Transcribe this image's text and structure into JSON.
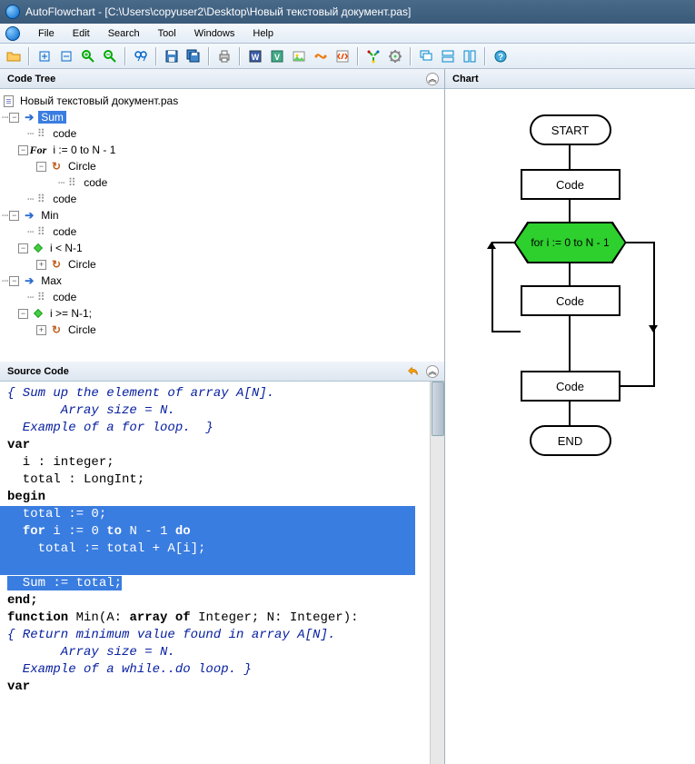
{
  "window": {
    "title": "AutoFlowchart - [C:\\Users\\copyuser2\\Desktop\\Новый текстовый документ.pas]"
  },
  "menubar": [
    "File",
    "Edit",
    "Search",
    "Tool",
    "Windows",
    "Help"
  ],
  "panels": {
    "code_tree": "Code Tree",
    "source": "Source Code",
    "chart": "Chart"
  },
  "tree": {
    "root": "Новый текстовый документ.pas",
    "items": [
      {
        "label": "Sum",
        "selected": true,
        "icon": "arrow"
      },
      {
        "label": "code",
        "icon": "code",
        "indent": 1
      },
      {
        "label": "i := 0 to N - 1",
        "icon": "for",
        "indent": 1,
        "prefix": "For"
      },
      {
        "label": "Circle",
        "icon": "loop",
        "indent": 2
      },
      {
        "label": "code",
        "icon": "code",
        "indent": 3
      },
      {
        "label": "code",
        "icon": "code",
        "indent": 1
      },
      {
        "label": "Min",
        "icon": "arrow"
      },
      {
        "label": "code",
        "icon": "code",
        "indent": 1
      },
      {
        "label": "i < N-1",
        "icon": "cond",
        "indent": 1
      },
      {
        "label": "Circle",
        "icon": "loop",
        "indent": 2
      },
      {
        "label": "Max",
        "icon": "arrow"
      },
      {
        "label": "code",
        "icon": "code",
        "indent": 1
      },
      {
        "label": "i >= N-1;",
        "icon": "cond",
        "indent": 1
      },
      {
        "label": "Circle",
        "icon": "loop",
        "indent": 2
      }
    ]
  },
  "source": {
    "lines": [
      {
        "t": "{ Sum up the element of array A[N].",
        "cls": "cm"
      },
      {
        "t": "       Array size = N.",
        "cls": "cm"
      },
      {
        "t": "  Example of a for loop.  }",
        "cls": "cm"
      },
      {
        "t": "var",
        "cls": "kw"
      },
      {
        "t": "  i : integer;"
      },
      {
        "t": "  total : LongInt;"
      },
      {
        "t": "begin",
        "cls": "kw"
      },
      {
        "t": "  total := 0;",
        "hl": true
      },
      {
        "t": "  for i := 0 to N - 1 do",
        "hl": true,
        "kw": [
          "for",
          "to",
          "do"
        ]
      },
      {
        "t": "    total := total + A[i];",
        "hl": true
      },
      {
        "t": "",
        "hl": true
      },
      {
        "t": "  Sum := total;",
        "hl": true
      },
      {
        "t": "end;",
        "cls": "kw"
      },
      {
        "t": ""
      },
      {
        "t": "function Min(A: array of Integer; N: Integer):",
        "kw": [
          "function",
          "array",
          "of"
        ]
      },
      {
        "t": "{ Return minimum value found in array A[N].",
        "cls": "cm"
      },
      {
        "t": "       Array size = N.",
        "cls": "cm"
      },
      {
        "t": "  Example of a while..do loop. }",
        "cls": "cm"
      },
      {
        "t": "var",
        "cls": "kw"
      }
    ]
  },
  "flowchart": {
    "start": "START",
    "code1": "Code",
    "loop": "for i := 0 to N - 1",
    "code2": "Code",
    "code3": "Code",
    "end": "END"
  }
}
